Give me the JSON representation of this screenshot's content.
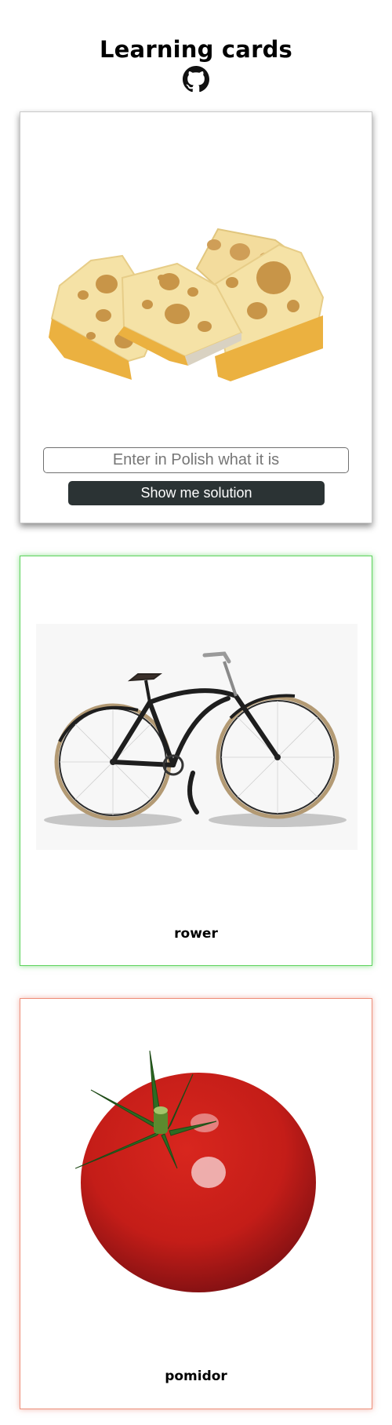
{
  "header": {
    "title": "Learning cards",
    "github_icon": "github-icon"
  },
  "cards": [
    {
      "image": "cheese",
      "input": {
        "placeholder": "Enter in Polish what it is",
        "value": ""
      },
      "button_label": "Show me solution"
    },
    {
      "image": "bicycle",
      "word": "rower",
      "status": "correct",
      "border_color": "#5dd35d"
    },
    {
      "image": "tomato",
      "word": "pomidor",
      "status": "incorrect",
      "border_color": "#ee8f7a"
    }
  ],
  "colors": {
    "button_bg": "#2b3334",
    "correct": "#5dd35d",
    "incorrect": "#ee8f7a"
  }
}
